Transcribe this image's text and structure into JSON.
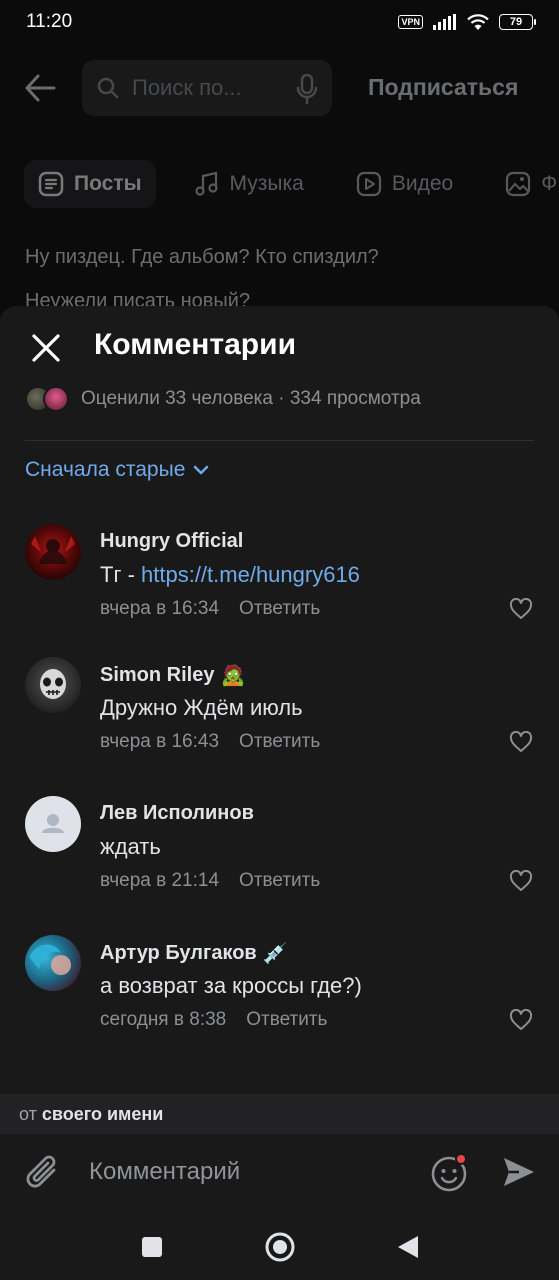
{
  "status_bar": {
    "time": "11:20",
    "vpn": "VPN",
    "battery": "79"
  },
  "background_page": {
    "search_placeholder": "Поиск по...",
    "subscribe_label": "Подписаться",
    "tabs": [
      {
        "label": "Посты",
        "icon": "posts-icon",
        "active": true
      },
      {
        "label": "Музыка",
        "icon": "music-icon",
        "active": false
      },
      {
        "label": "Видео",
        "icon": "video-icon",
        "active": false
      },
      {
        "label": "Ф",
        "icon": "photo-icon",
        "active": false
      }
    ],
    "post_line_1": "Ну пиздец. Где альбом? Кто спиздил?",
    "post_line_2": "Неужели писать новый?"
  },
  "sheet": {
    "title": "Комментарии",
    "stats": "Оценили 33 человека · 334 просмотра",
    "sort_label": "Сначала старые"
  },
  "comments": [
    {
      "author": "Hungry Official",
      "text_prefix": "Тг - ",
      "link": "https://t.me/hungry616",
      "time": "вчера в 16:34",
      "reply": "Ответить",
      "emoji": ""
    },
    {
      "author": "Simon Riley",
      "text_prefix": "Дружно Ждём июль",
      "link": "",
      "time": "вчера в 16:43",
      "reply": "Ответить",
      "emoji": "🧟"
    },
    {
      "author": "Лев Исполинов",
      "text_prefix": "ждать",
      "link": "",
      "time": "вчера в 21:14",
      "reply": "Ответить",
      "emoji": ""
    },
    {
      "author": "Артур Булгаков",
      "text_prefix": "а возврат за кроссы где?)",
      "link": "",
      "time": "сегодня в 8:38",
      "reply": "Ответить",
      "emoji": "💉"
    }
  ],
  "compose": {
    "from_prefix": "от",
    "from_name": "своего имени",
    "placeholder": "Комментарий"
  },
  "colors": {
    "accent": "#71aaeb",
    "sheet_bg": "#19191a",
    "text": "#e1e3e6",
    "secondary": "#8c8f93",
    "notification_dot": "#e64646"
  }
}
